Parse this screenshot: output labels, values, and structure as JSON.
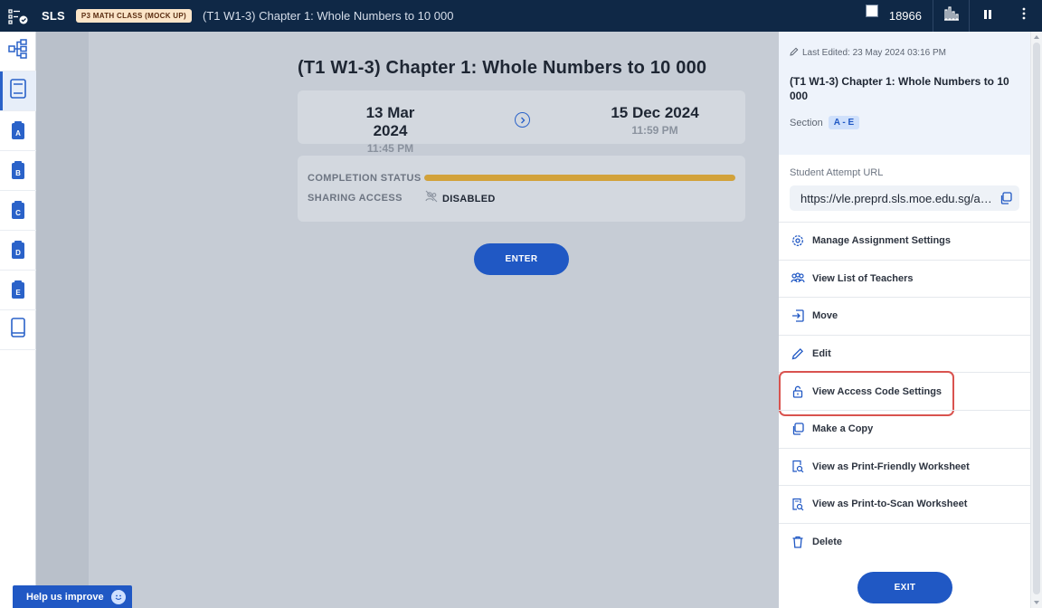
{
  "topbar": {
    "brand": "SLS",
    "class_badge": "P3 MATH CLASS (MOCK UP)",
    "title": "(T1 W1-3) Chapter 1: Whole Numbers to 10 000",
    "points": "18966",
    "icons": [
      "class-menu-icon",
      "stats-icon",
      "pause-icon",
      "more-vertical-icon"
    ]
  },
  "rail": {
    "items": [
      {
        "icon": "assignment-tree-icon",
        "label": ""
      },
      {
        "icon": "notebook-icon",
        "label": ""
      },
      {
        "icon": "doc-icon",
        "label": "A"
      },
      {
        "icon": "doc-icon",
        "label": "B"
      },
      {
        "icon": "doc-icon",
        "label": "C"
      },
      {
        "icon": "doc-icon",
        "label": "D"
      },
      {
        "icon": "doc-icon",
        "label": "E"
      },
      {
        "icon": "book-icon",
        "label": ""
      }
    ]
  },
  "main": {
    "title": "(T1 W1-3) Chapter 1: Whole Numbers to 10 000",
    "start": {
      "date": "13 Mar 2024",
      "time": "11:45 PM"
    },
    "end": {
      "date": "15 Dec 2024",
      "time": "11:59 PM"
    },
    "completion_label": "COMPLETION STATUS",
    "completion_fraction": 1.0,
    "sharing_label": "SHARING ACCESS",
    "sharing_value": "DISABLED",
    "enter_label": "ENTER"
  },
  "help": {
    "label": "Help us improve"
  },
  "panel": {
    "last_edited": "Last Edited: 23 May 2024 03:16 PM",
    "title": "(T1 W1-3) Chapter 1: Whole Numbers to 10 000",
    "section_label": "Section",
    "section_value": "A - E",
    "url_label": "Student Attempt URL",
    "url_value": "https://vle.preprd.sls.moe.edu.sg/as...",
    "menu": [
      {
        "label": "Manage Assignment Settings",
        "icon": "gear-icon"
      },
      {
        "label": "View List of Teachers",
        "icon": "teachers-icon"
      },
      {
        "label": "Move",
        "icon": "move-icon"
      },
      {
        "label": "Edit",
        "icon": "pencil-icon"
      },
      {
        "label": "View Access Code Settings",
        "icon": "lock-icon"
      },
      {
        "label": "Make a Copy",
        "icon": "copy-icon"
      },
      {
        "label": "View as Print-Friendly Worksheet",
        "icon": "print-search-icon"
      },
      {
        "label": "View as Print-to-Scan Worksheet",
        "icon": "scan-search-icon"
      },
      {
        "label": "Delete",
        "icon": "trash-icon"
      }
    ],
    "exit_label": "EXIT"
  },
  "colors": {
    "topbar": "#0f2846",
    "accent": "#2058c4",
    "progress": "#d2a23a",
    "highlight": "#d9534f"
  }
}
